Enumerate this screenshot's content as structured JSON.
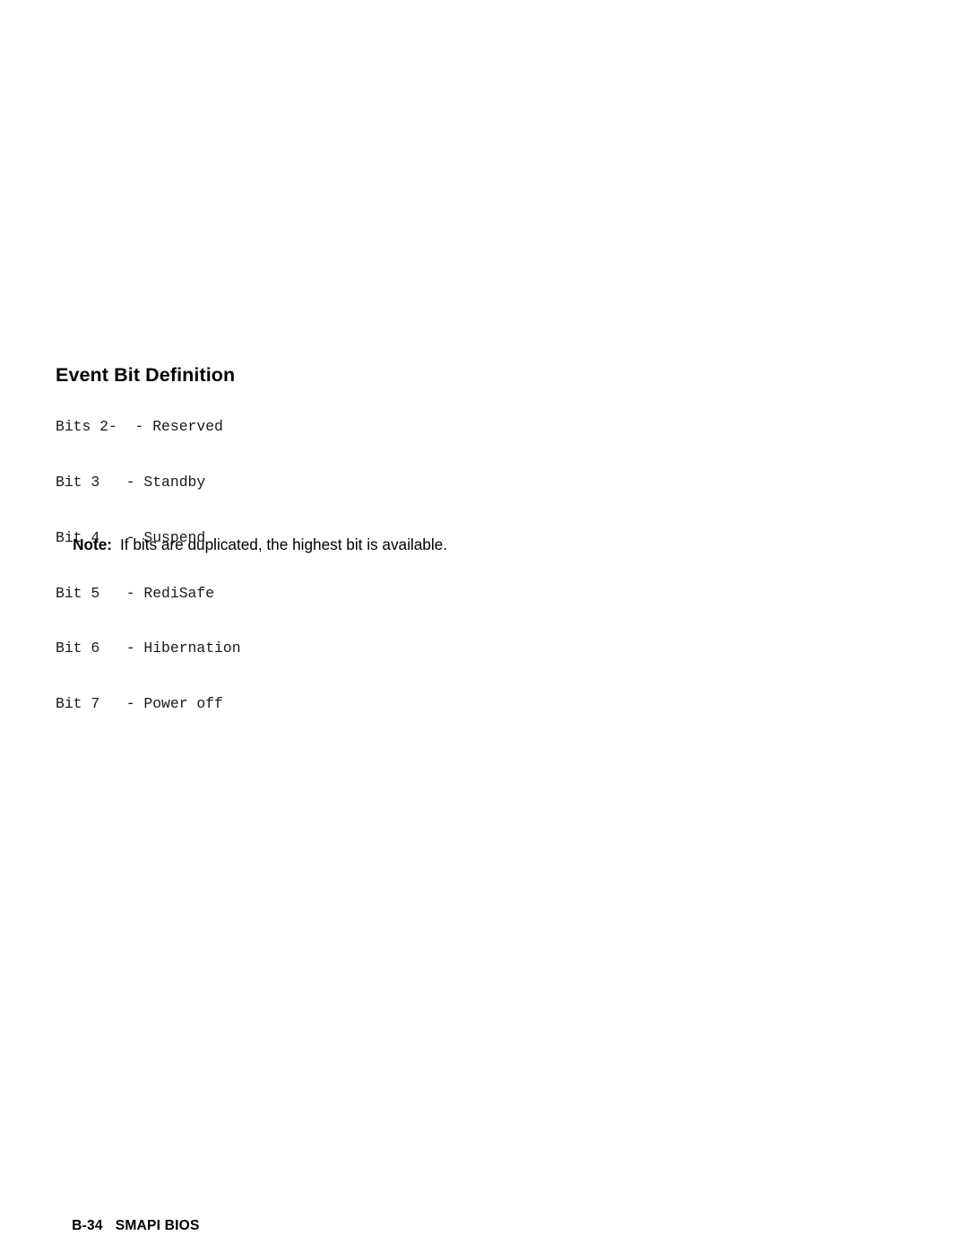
{
  "document": {
    "background_color": "#ffffff",
    "text_color": "#000000"
  },
  "section": {
    "heading": "Event Bit Definition"
  },
  "bit_list": {
    "lines": [
      "Bits 2-  - Reserved",
      "Bit 3   - Standby",
      "Bit 4   - Suspend",
      "Bit 5   - RediSafe",
      "Bit 6   - Hibernation",
      "Bit 7   - Power off"
    ],
    "entries": [
      {
        "bit": "Bits 2-",
        "separator": "-",
        "description": "Reserved"
      },
      {
        "bit": "Bit 3",
        "separator": "-",
        "description": "Standby"
      },
      {
        "bit": "Bit 4",
        "separator": "-",
        "description": "Suspend"
      },
      {
        "bit": "Bit 5",
        "separator": "-",
        "description": "RediSafe"
      },
      {
        "bit": "Bit 6",
        "separator": "-",
        "description": "Hibernation"
      },
      {
        "bit": "Bit 7",
        "separator": "-",
        "description": "Power off"
      }
    ]
  },
  "note": {
    "label": "Note:",
    "text": "If bits are duplicated, the highest bit is available."
  },
  "footer": {
    "page_number": "B-34",
    "title": "SMAPI BIOS"
  }
}
